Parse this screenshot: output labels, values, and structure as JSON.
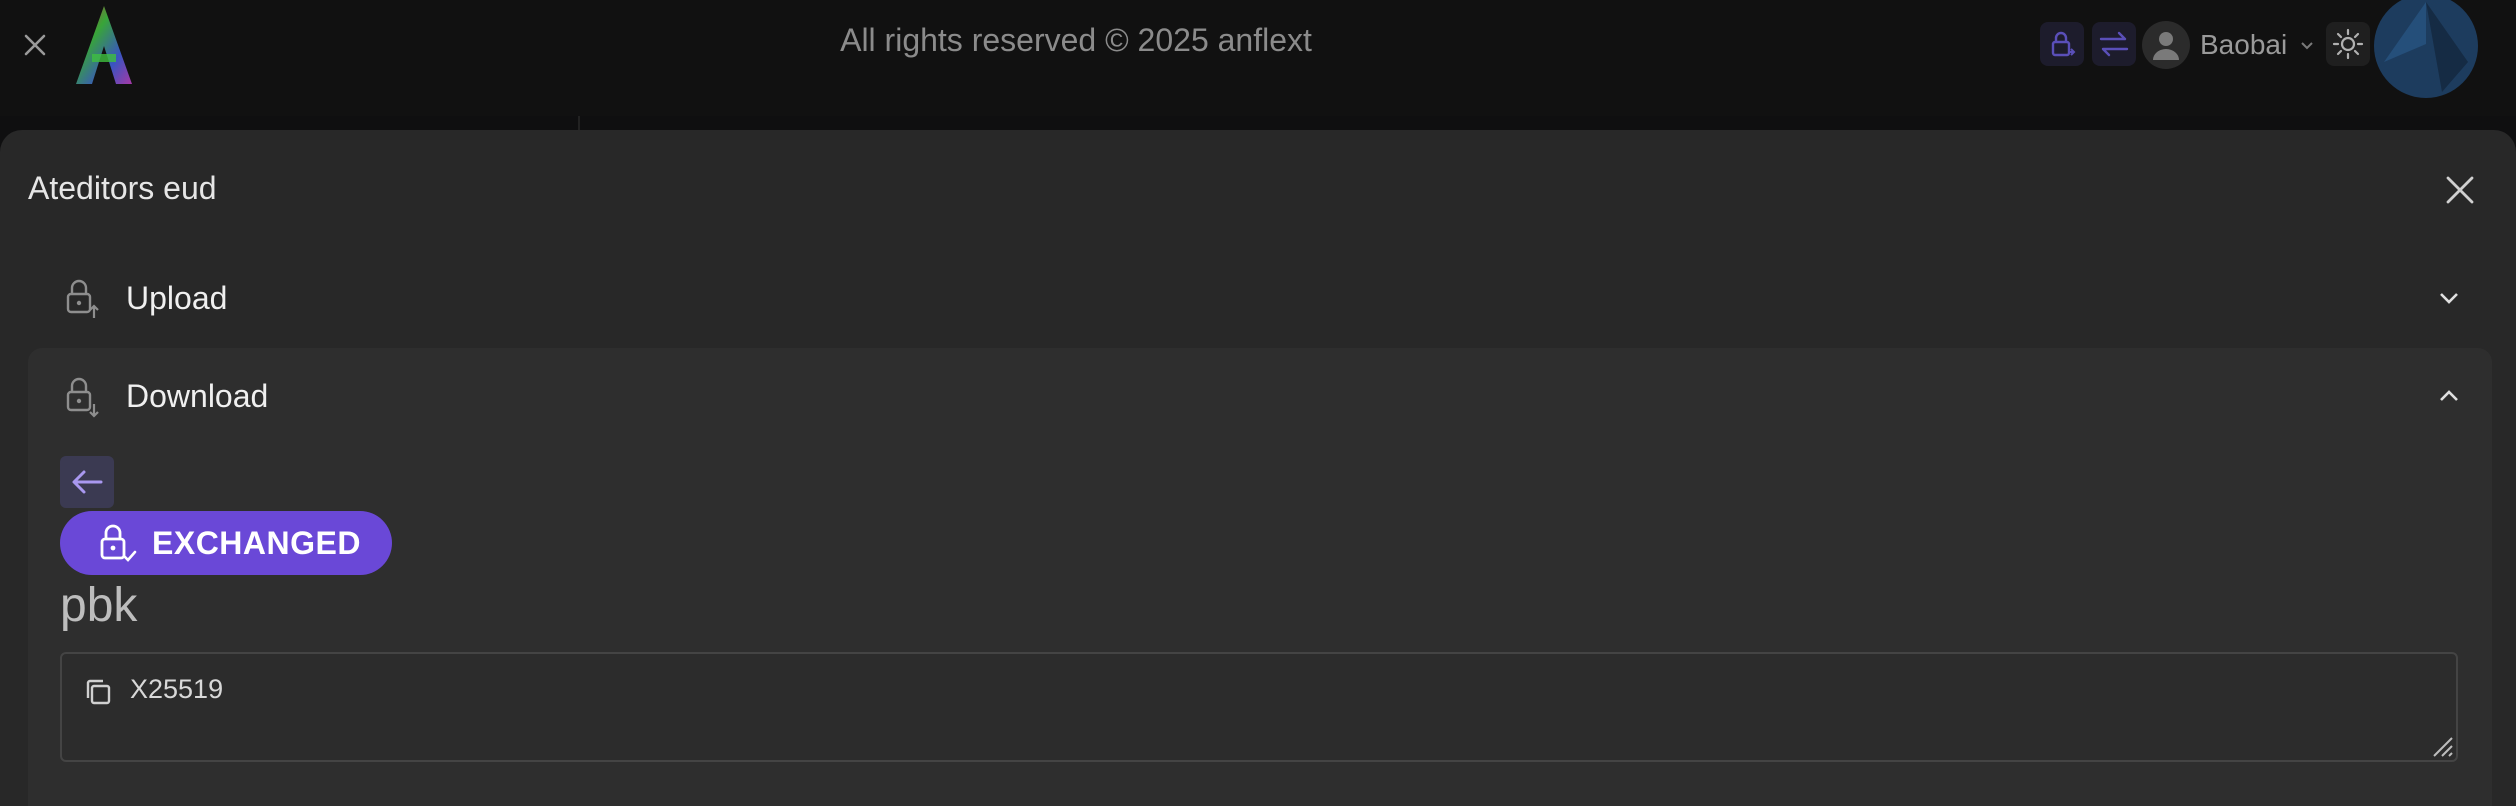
{
  "topbar": {
    "copyright": "All rights reserved © 2025 anflext",
    "username": "Baobai"
  },
  "modal": {
    "title": "Ateditors eud",
    "upload_label": "Upload",
    "download_label": "Download",
    "badge_text": "EXCHANGED",
    "field_label": "pbk",
    "field_value": "X25519"
  },
  "colors": {
    "accent": "#6a48d7",
    "panel": "#2e2e2e",
    "modal_bg": "#282828"
  },
  "icons": {
    "close": "close-icon",
    "logo": "logo-icon",
    "lock_exchange": "lock-exchange-icon",
    "swap": "swap-icon",
    "user": "user-icon",
    "theme": "sun-icon",
    "upload": "lock-upload-icon",
    "download": "lock-download-icon",
    "back": "arrow-left-icon",
    "copy": "copy-icon"
  }
}
